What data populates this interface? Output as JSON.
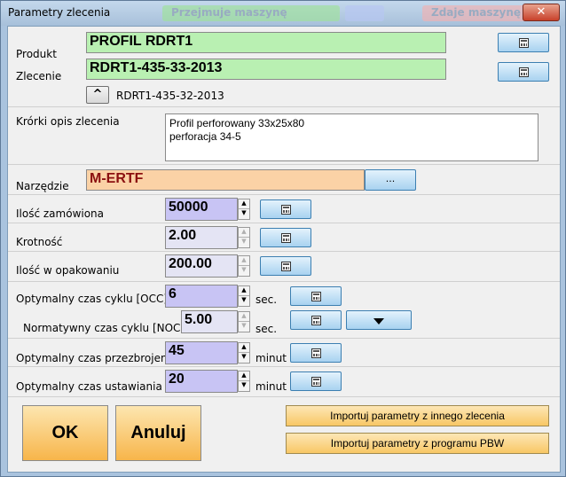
{
  "window": {
    "title": "Parametry zlecenia",
    "bg_tab1": "Przejmuje maszynę",
    "bg_tab2": "Zdaje maszynę",
    "close_glyph": "✕"
  },
  "product": {
    "label": "Produkt",
    "value": "PROFIL RDRT1"
  },
  "order": {
    "label": "Zlecenie",
    "value": "RDRT1-435-33-2013",
    "prev_button": "^",
    "prev_value": "RDRT1-435-32-2013"
  },
  "description": {
    "label": "Krórki opis zlecenia",
    "lines": [
      "Profil perforowany 33x25x80",
      "perforacja 34-5"
    ]
  },
  "tool": {
    "label": "Narzędzie",
    "value": "M-ERTF",
    "browse_label": "..."
  },
  "quantity_ordered": {
    "label": "Ilość zamówiona",
    "value": "50000"
  },
  "multiplicity": {
    "label": "Krotność",
    "value": "2.00"
  },
  "quantity_package": {
    "label": "Ilość w opakowaniu",
    "value": "200.00"
  },
  "occ": {
    "label": "Optymalny czas cyklu  [OCC]",
    "value": "6",
    "unit": "sec."
  },
  "nocc": {
    "label": "Normatywny czas cyklu  [NOCC]",
    "value": "5.00",
    "unit": "sec."
  },
  "changeover": {
    "label": "Optymalny czas przezbrojenia",
    "value": "45",
    "unit": "minut"
  },
  "setup": {
    "label": "Optymalny czas ustawiania",
    "value": "20",
    "unit": "minut"
  },
  "buttons": {
    "ok": "OK",
    "cancel": "Anuluj",
    "import_other": "Importuj parametry z  innego zlecenia",
    "import_pbw": "Importuj parametry z programu PBW"
  },
  "colors": {
    "green_field": "#b9f0b2",
    "orange_field": "#fbd2a6",
    "num_field": "#c8c4f4",
    "tool_text": "#8b1010"
  }
}
